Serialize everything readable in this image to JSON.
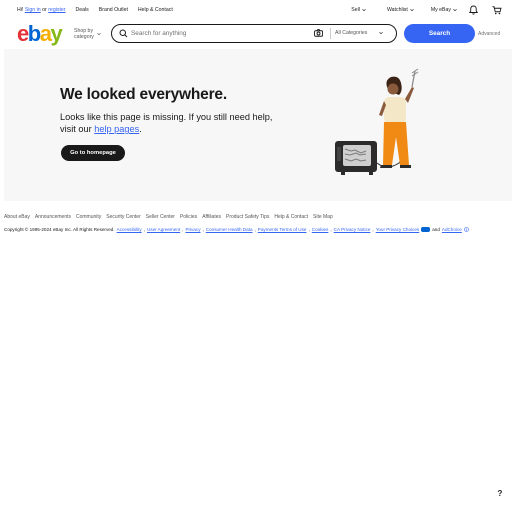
{
  "topbar": {
    "greeting_prefix": "Hi!",
    "sign_in": "Sign in",
    "or": "or",
    "register": "register",
    "links": [
      "Deals",
      "Brand Outlet",
      "Help & Contact"
    ],
    "sell": "Sell",
    "watchlist": "Watchlist",
    "my_ebay": "My eBay"
  },
  "header": {
    "logo": {
      "e": "e",
      "b": "b",
      "a": "a",
      "y": "y"
    },
    "shop_by_line1": "Shop by",
    "shop_by_line2": "category",
    "search_placeholder": "Search for anything",
    "category": "All Categories",
    "search_button": "Search",
    "advanced": "Advanced"
  },
  "hero": {
    "title": "We looked everywhere.",
    "message_text": "Looks like this page is missing. If you still need help, visit our ",
    "help_link": "help pages",
    "message_end": ".",
    "button": "Go to homepage"
  },
  "footer": {
    "links": [
      "About eBay",
      "Announcements",
      "Community",
      "Security Center",
      "Seller Center",
      "Policies",
      "Affiliates",
      "Product Safety Tips",
      "Help & Contact",
      "Site Map"
    ],
    "copyright_prefix": "Copyright © 1995-2024 eBay Inc. All Rights Reserved.",
    "legal_links": [
      "Accessibility",
      "User Agreement",
      "Privacy",
      "Consumer Health Data",
      "Payments Terms of Use",
      "Cookies",
      "CA Privacy Notice",
      "Your Privacy Choices"
    ],
    "and": "and",
    "adchoice": "AdChoice"
  },
  "help_button": "?",
  "colors": {
    "accent": "#3665f3",
    "dark": "#191919",
    "hero_bg": "#f7f7f7"
  },
  "icons": [
    "chevron-down-icon",
    "bell-icon",
    "cart-icon",
    "search-icon",
    "camera-icon",
    "help-icon"
  ]
}
